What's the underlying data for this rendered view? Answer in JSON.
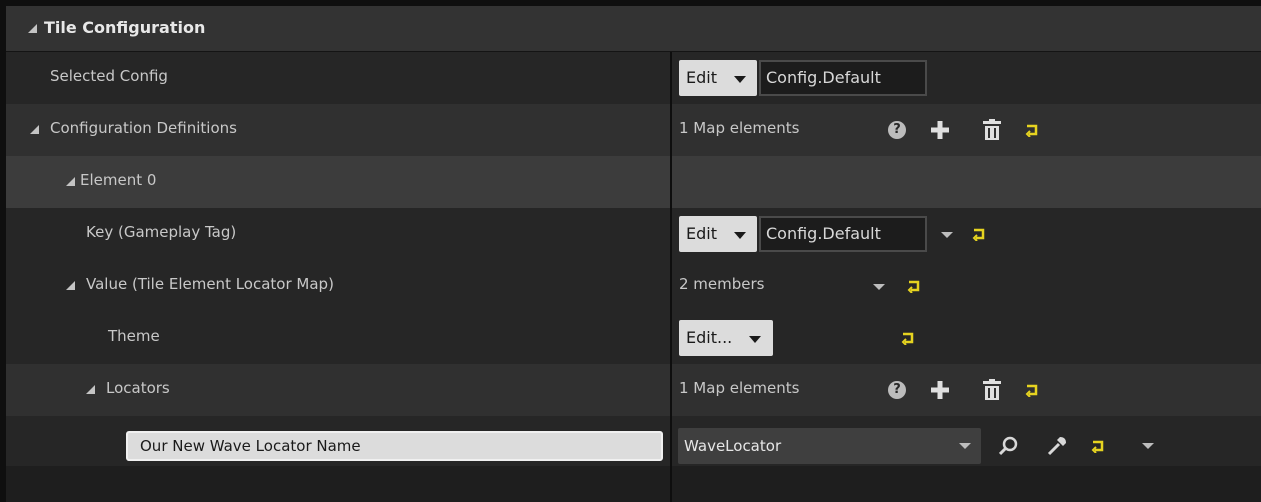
{
  "section": {
    "title": "Tile Configuration"
  },
  "rows": {
    "selected_config": {
      "label": "Selected Config",
      "edit_label": "Edit",
      "tag_value": "Config.Default"
    },
    "configuration_definitions": {
      "label": "Configuration Definitions",
      "summary": "1 Map elements"
    },
    "element0": {
      "label": "Element 0"
    },
    "key": {
      "label": "Key (Gameplay Tag)",
      "edit_label": "Edit",
      "tag_value": "Config.Default"
    },
    "value": {
      "label": "Value (Tile Element Locator Map)",
      "summary": "2 members"
    },
    "theme": {
      "label": "Theme",
      "edit_label": "Edit..."
    },
    "locators": {
      "label": "Locators",
      "summary": "1 Map elements"
    },
    "locator_entry": {
      "key_value": "Our New Wave Locator Name",
      "asset_value": "WaveLocator"
    }
  },
  "icons": {
    "help": "help-icon",
    "add": "plus-icon",
    "delete": "trash-icon",
    "reset": "reset-arrow-icon",
    "browse": "search-icon",
    "use_selected": "eyedropper-icon",
    "dropdown": "chevron-down-icon"
  },
  "colors": {
    "reset_accent": "#e6d320",
    "button_bg": "#dcdcdc",
    "panel_bg": "#1e1e1e",
    "header_bg": "#333333"
  }
}
